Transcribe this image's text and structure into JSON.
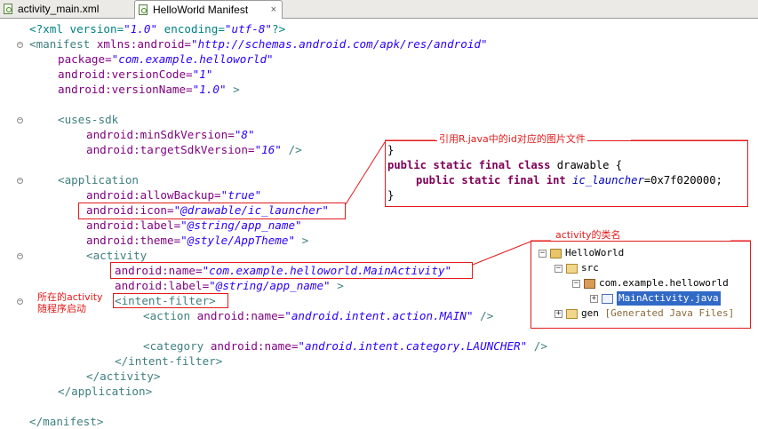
{
  "tabs": [
    {
      "label": "activity_main.xml",
      "icon": "xml-file-icon"
    },
    {
      "label": "HelloWorld Manifest",
      "icon": "manifest-file-icon",
      "close": "×"
    }
  ],
  "code": {
    "l1": {
      "open": "<?xml version=",
      "v1": "\"1.0\"",
      "mid": " encoding=",
      "v2": "\"utf-8\"",
      "close": "?>"
    },
    "l2": {
      "tag": "<manifest",
      "attr": " xmlns:android=",
      "val": "\"http://schemas.android.com/apk/res/android\""
    },
    "l3": {
      "attr": "package=",
      "val": "\"com.example.helloworld\""
    },
    "l4": {
      "attr": "android:versionCode=",
      "val": "\"1\""
    },
    "l5": {
      "attr": "android:versionName=",
      "val": "\"1.0\"",
      "tail": " >"
    },
    "l7": {
      "tag": "<uses-sdk"
    },
    "l8": {
      "attr": "android:minSdkVersion=",
      "val": "\"8\""
    },
    "l9": {
      "attr": "android:targetSdkVersion=",
      "val": "\"16\"",
      "tail": " />"
    },
    "l11": {
      "tag": "<application"
    },
    "l12": {
      "attr": "android:allowBackup=",
      "val": "\"true\""
    },
    "l13": {
      "attr": "android:icon=",
      "val": "\"@drawable/ic_launcher\""
    },
    "l14": {
      "attr": "android:label=",
      "val": "\"@string/app_name\""
    },
    "l15": {
      "attr": "android:theme=",
      "val": "\"@style/AppTheme\"",
      "tail": " >"
    },
    "l16": {
      "tag": "<activity"
    },
    "l17": {
      "attr": "android:name=",
      "val": "\"com.example.helloworld.MainActivity\""
    },
    "l18": {
      "attr": "android:label=",
      "val": "\"@string/app_name\"",
      "tail": " >"
    },
    "l19": {
      "tag": "<intent-filter>"
    },
    "l20": {
      "tag": "<action",
      "attr": " android:name=",
      "val": "\"android.intent.action.MAIN\"",
      "tail": " />"
    },
    "l22": {
      "tag": "<category",
      "attr": " android:name=",
      "val": "\"android.intent.category.LAUNCHER\"",
      "tail": " />"
    },
    "l23": {
      "tag": "</intent-filter>"
    },
    "l24": {
      "tag": "</activity>"
    },
    "l25": {
      "tag": "</application>"
    },
    "l27": {
      "tag": "</manifest>"
    }
  },
  "annotations": {
    "drawable": "引用R.java中的id对应的图片文件",
    "activity_class": "activity的类名",
    "launcher": "所在的activity\n随程序启动"
  },
  "java": {
    "brace_close": "}",
    "l2": {
      "k1": "public static final class",
      "rest": " drawable {"
    },
    "l3": {
      "k1": "public static final int",
      "name": "ic_launcher",
      "rest": "=0x7f020000;"
    }
  },
  "tree": {
    "project": "HelloWorld",
    "src": "src",
    "package": "com.example.helloworld",
    "file": "MainActivity.java",
    "gen": "gen",
    "gen_note": "[Generated Java Files]"
  },
  "colors": {
    "annotation": "#e31a1a",
    "tag": "#3f7f7f",
    "attr": "#7f007f",
    "value": "#2a00ff",
    "keyword": "#7f0055"
  }
}
